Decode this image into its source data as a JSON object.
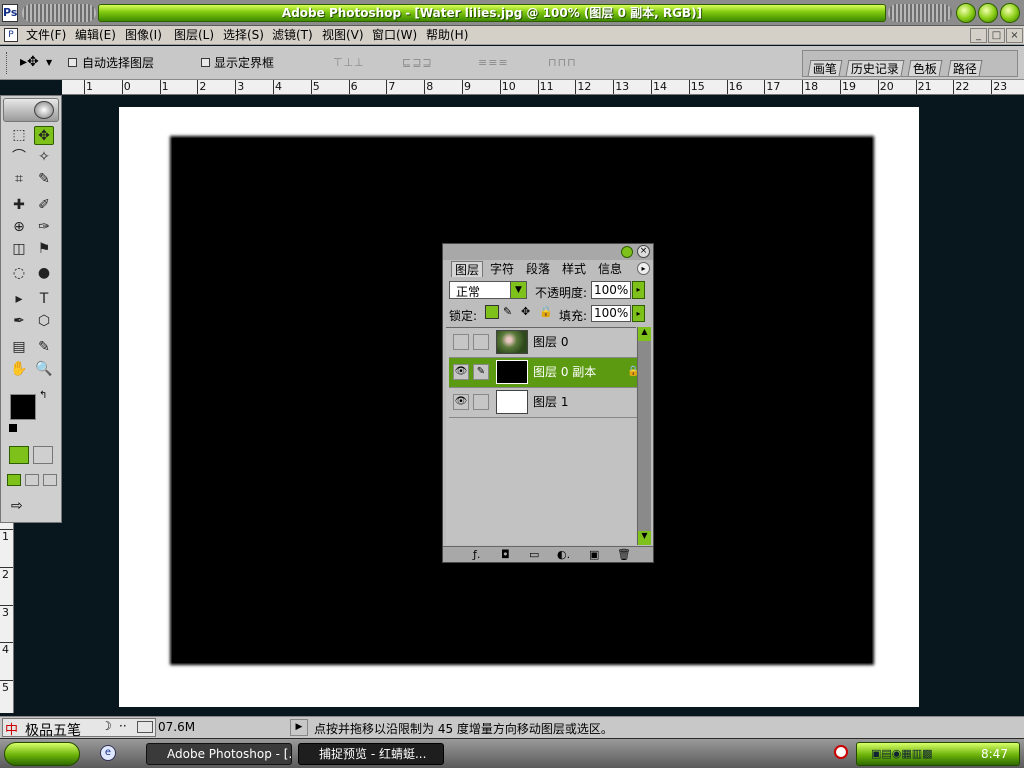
{
  "window": {
    "title": "Adobe Photoshop - [Water lilies.jpg @ 100% (图层 0 副本, RGB)]",
    "app_icon": "Ps"
  },
  "menu": {
    "items": [
      "文件(F)",
      "编辑(E)",
      "图像(I)",
      "图层(L)",
      "选择(S)",
      "滤镜(T)",
      "视图(V)",
      "窗口(W)",
      "帮助(H)"
    ],
    "window_controls": [
      "_",
      "□",
      "×"
    ]
  },
  "options": {
    "tool_glyph": "▸✥",
    "auto_select_label": "自动选择图层",
    "show_bounds_label": "显示定界框",
    "align_icons": [
      "⊤⊥⊥",
      "⊑⊒⊒",
      "≡≡≡",
      "⊓⊓⊓"
    ],
    "well_tabs": [
      "画笔",
      "历史记录",
      "色板",
      "路径"
    ]
  },
  "ruler": {
    "h_ticks": [
      "1",
      "0",
      "1",
      "2",
      "3",
      "4",
      "5",
      "6",
      "7",
      "8",
      "9",
      "10",
      "11",
      "12",
      "13",
      "14",
      "15",
      "16",
      "17",
      "18",
      "19",
      "20",
      "21",
      "22",
      "23"
    ],
    "v_ticks": [
      "1",
      "2",
      "3",
      "4",
      "5"
    ]
  },
  "toolbox": {
    "tools": [
      "⬚",
      "✥",
      "⌒",
      "✧",
      "⌗",
      "✎",
      "✚",
      "✐",
      "⊕",
      "✑",
      "◫",
      "⚑",
      "◌",
      "●",
      "▸",
      "T",
      "✒",
      "⬡",
      "▤",
      "✎",
      "✋",
      "🔍"
    ]
  },
  "layers_panel": {
    "tabs": [
      "图层",
      "字符",
      "段落",
      "样式",
      "信息"
    ],
    "blend_mode": "正常",
    "opacity_label": "不透明度:",
    "opacity_value": "100%",
    "lock_label": "锁定:",
    "fill_label": "填充:",
    "fill_value": "100%",
    "layers": [
      {
        "name": "图层 0",
        "visible": false,
        "selected": false,
        "thumb": "image"
      },
      {
        "name": "图层 0 副本",
        "visible": true,
        "selected": true,
        "thumb": "black"
      },
      {
        "name": "图层 1",
        "visible": true,
        "selected": false,
        "thumb": "white"
      }
    ],
    "footer_icons": [
      "ƒ.",
      "◘",
      "▭",
      "◐.",
      "▣",
      "🗑"
    ]
  },
  "status": {
    "ime_label": "极品五笔",
    "doc_size": "07.6M",
    "hint": "点按并拖移以沿限制为 45 度增量方向移动图层或选区。"
  },
  "taskbar": {
    "tasks": [
      "Adobe Photoshop - [...",
      "捕捉预览 - 红蜻蜓..."
    ],
    "clock": "8:47"
  },
  "colors": {
    "accent": "#7ec11a",
    "selected_layer": "#5c9a12",
    "workspace": "#08161e"
  }
}
